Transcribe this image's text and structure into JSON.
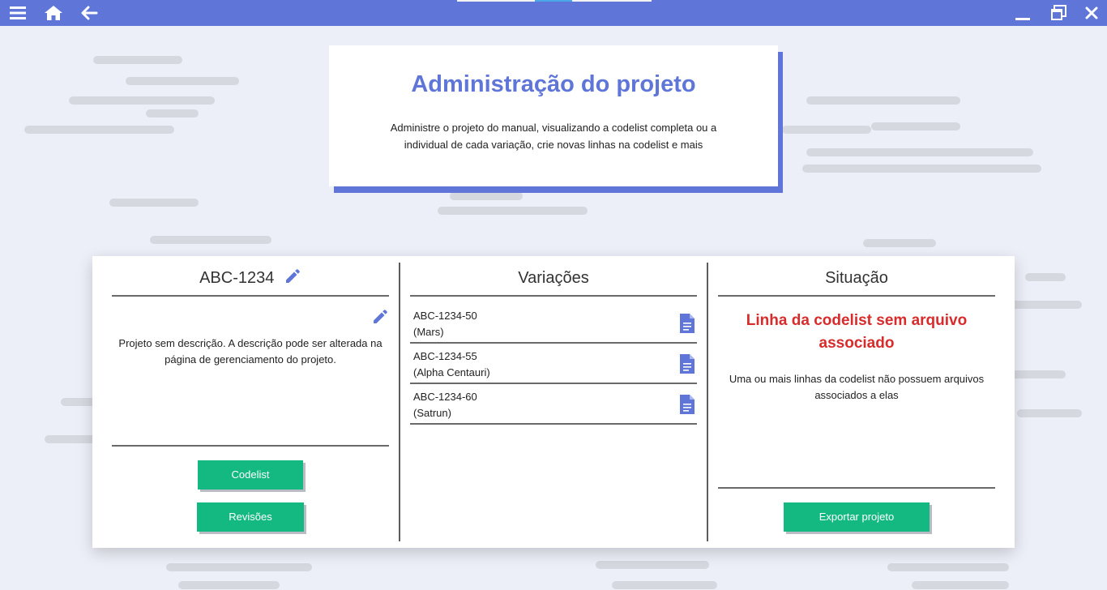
{
  "toolbar": {
    "left_icons": [
      "menu-icon",
      "home-icon",
      "arrow-left-icon"
    ],
    "right_icons": [
      "minimize-icon",
      "restore-icon",
      "close-icon"
    ],
    "accent": "#5f76d8"
  },
  "header": {
    "title": "Administração do projeto",
    "description": "Administre o projeto do manual, visualizando a codelist completa ou a individual de cada variação, crie novas linhas na codelist e mais"
  },
  "project": {
    "code": "ABC-1234",
    "description": "Projeto sem descrição. A descrição pode ser alterada na página de gerenciamento do projeto.",
    "codelist_button": "Codelist",
    "revisions_button": "Revisões",
    "button_color": "#14b981"
  },
  "variations": {
    "title": "Variações",
    "items": [
      {
        "code": "ABC-1234-50",
        "name": "(Mars)"
      },
      {
        "code": "ABC-1234-55",
        "name": "(Alpha Centauri)"
      },
      {
        "code": "ABC-1234-60",
        "name": "(Satrun)"
      }
    ]
  },
  "status": {
    "title": "Situação",
    "headline": "Linha da codelist sem arquivo associado",
    "headline_color": "#d82b2b",
    "description": "Uma ou mais linhas da codelist não possuem arquivos associados a elas",
    "export_button": "Exportar projeto"
  }
}
